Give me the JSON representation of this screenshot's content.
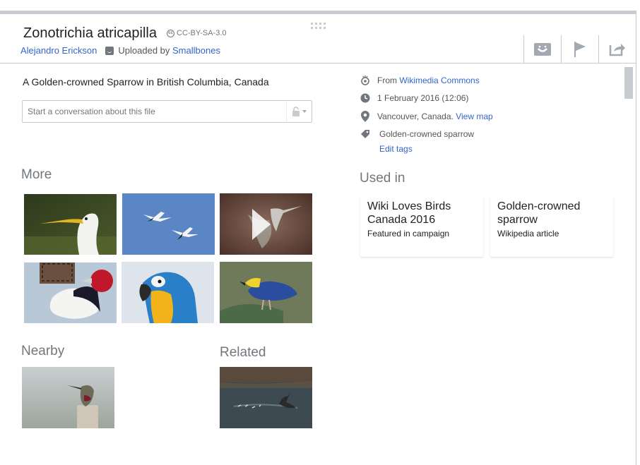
{
  "header": {
    "title": "Zonotrichia atricapilla",
    "license": "CC-BY-SA-3.0",
    "author": "Alejandro Erickson",
    "uploaded_by_prefix": "Uploaded by",
    "uploader": "Smallbones",
    "buttons": [
      {
        "icon": "smiley-icon",
        "name": "thanks-button"
      },
      {
        "icon": "flag-icon",
        "name": "report-button"
      },
      {
        "icon": "share-icon",
        "name": "share-button"
      }
    ]
  },
  "description": "A Golden-crowned Sparrow in British Columbia, Canada",
  "conversation": {
    "placeholder": "Start a conversation about this file"
  },
  "sections": {
    "more": "More",
    "nearby": "Nearby",
    "related": "Related",
    "used_in": "Used in"
  },
  "more_thumbs": [
    {
      "subject": "great egret"
    },
    {
      "subject": "snow geese in flight"
    },
    {
      "subject": "hummingbird video"
    },
    {
      "subject": "red-headed woodpecker"
    },
    {
      "subject": "blue-and-yellow macaw"
    },
    {
      "subject": "pitta"
    }
  ],
  "nearby_thumb": {
    "subject": "hummingbird on post"
  },
  "related_thumb": {
    "subject": "goose landing on water"
  },
  "meta": {
    "source_prefix": "From",
    "source_link": "Wikimedia Commons",
    "date": "1 February 2016 (12:06)",
    "location": "Vancouver, Canada.",
    "view_map": "View map",
    "tag": "Golden-crowned sparrow",
    "edit_tags": "Edit tags"
  },
  "used_in": [
    {
      "title": "Wiki Loves Birds Canada 2016",
      "subtitle": "Featured in campaign"
    },
    {
      "title": "Golden-crowned sparrow",
      "subtitle": "Wikipedia article"
    }
  ],
  "colors": {
    "link": "#3366cc",
    "muted": "#72777d",
    "border": "#c8ccd1"
  }
}
